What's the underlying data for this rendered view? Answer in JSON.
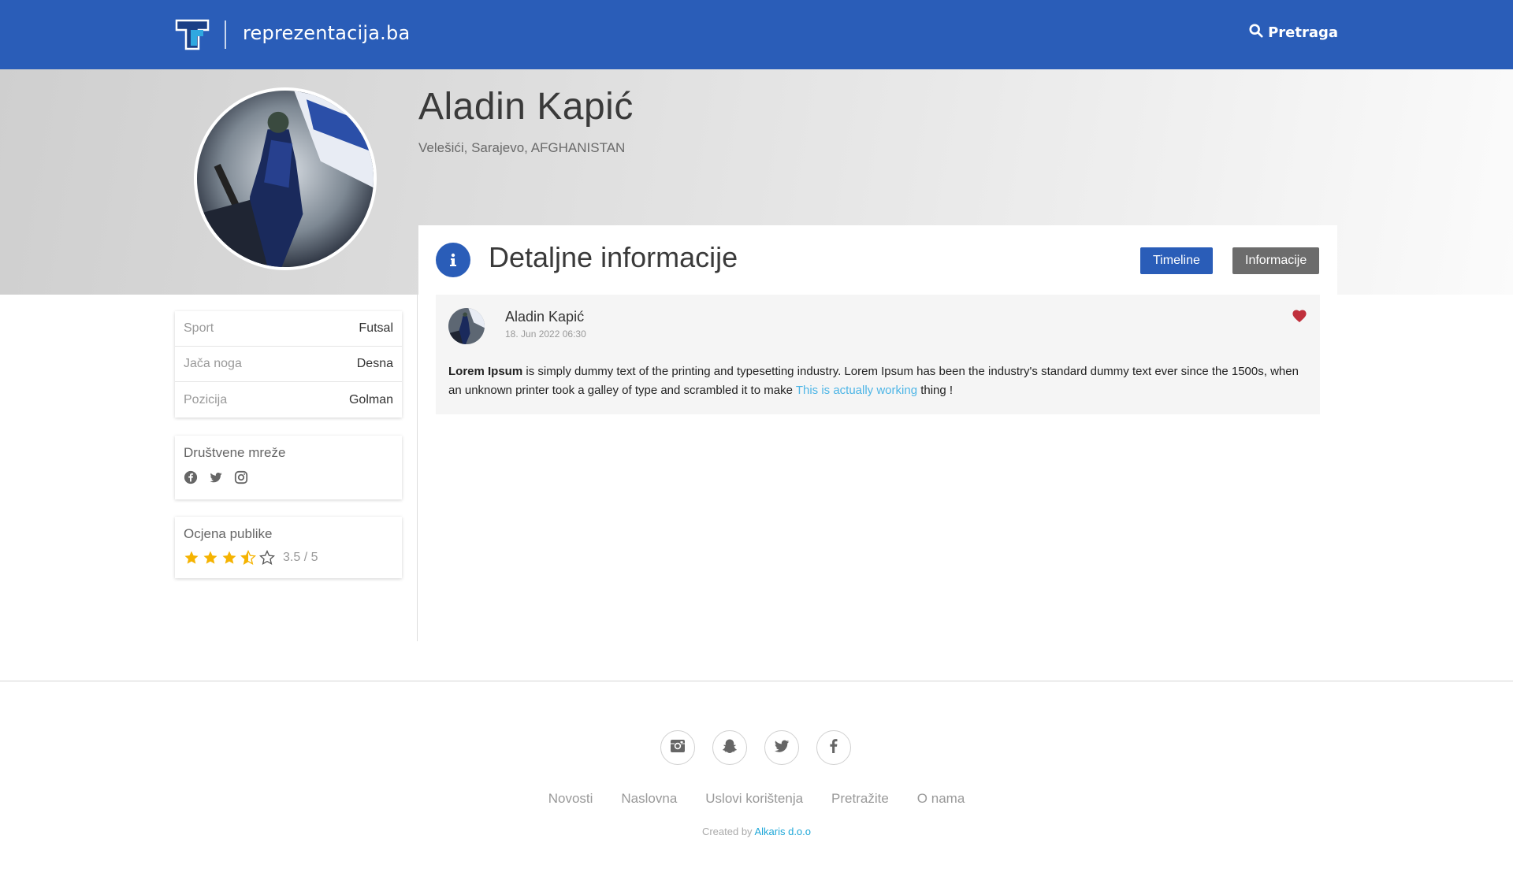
{
  "header": {
    "brand": "reprezentacija.ba",
    "search_label": "Pretraga",
    "colors": {
      "bar": "#2a5db8"
    }
  },
  "profile": {
    "name": "Aladin Kapić",
    "location": "Velešići, Sarajevo, AFGHANISTAN"
  },
  "info_card": {
    "rows": [
      {
        "label": "Sport",
        "value": "Futsal"
      },
      {
        "label": "Jača noga",
        "value": "Desna"
      },
      {
        "label": "Pozicija",
        "value": "Golman"
      }
    ]
  },
  "social_card": {
    "title": "Društvene mreže",
    "icons": [
      "facebook-icon",
      "twitter-icon",
      "instagram-icon"
    ]
  },
  "rating_card": {
    "title": "Ocjena publike",
    "rating": 3.5,
    "max": 5,
    "text": "3.5 / 5",
    "star_color": "#f5b301"
  },
  "panel": {
    "title": "Detaljne informacije",
    "buttons": {
      "timeline": "Timeline",
      "info": "Informacije"
    }
  },
  "post": {
    "author": "Aladin Kapić",
    "date": "18. Jun 2022 06:30",
    "text_bold": "Lorem Ipsum",
    "text_body": " is simply dummy text of the printing and typesetting industry. Lorem Ipsum has been the industry's standard dummy text ever since the 1500s, when an unknown printer took a galley of type and scrambled it to make ",
    "text_link": "This is actually working",
    "text_end": " thing !",
    "heart_color": "#c0303c"
  },
  "footer": {
    "social": [
      "instagram-icon",
      "snapchat-icon",
      "twitter-icon",
      "facebook-icon"
    ],
    "nav": [
      "Novosti",
      "Naslovna",
      "Uslovi korištenja",
      "Pretražite",
      "O nama"
    ],
    "credit_prefix": "Created by ",
    "credit_link": "Alkaris d.o.o"
  }
}
